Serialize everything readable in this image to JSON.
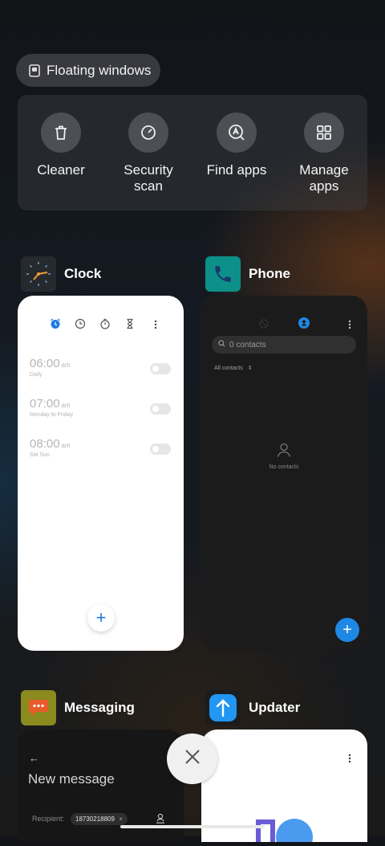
{
  "floating": {
    "label": "Floating windows"
  },
  "quick_actions": [
    {
      "label": "Cleaner",
      "icon": "trash-icon"
    },
    {
      "label": "Security scan",
      "icon": "shield-scan-icon"
    },
    {
      "label": "Find apps",
      "icon": "find-apps-icon"
    },
    {
      "label": "Manage apps",
      "icon": "grid-icon"
    }
  ],
  "apps": {
    "clock": {
      "name": "Clock",
      "alarms": [
        {
          "time": "06:00",
          "ampm": "am",
          "repeat": "Daily"
        },
        {
          "time": "07:00",
          "ampm": "am",
          "repeat": "Monday to Friday"
        },
        {
          "time": "08:00",
          "ampm": "am",
          "repeat": "Sat Sun"
        }
      ]
    },
    "phone": {
      "name": "Phone",
      "search_placeholder": "0 contacts",
      "filter_label": "All contacts",
      "empty_label": "No contacts"
    },
    "messaging": {
      "name": "Messaging",
      "title": "New message",
      "recipient_label": "Recipient:",
      "recipient_value": "18730218809"
    },
    "updater": {
      "name": "Updater"
    }
  },
  "colors": {
    "accent_blue": "#1e88e5",
    "clock_accent": "#1f7ae0"
  }
}
